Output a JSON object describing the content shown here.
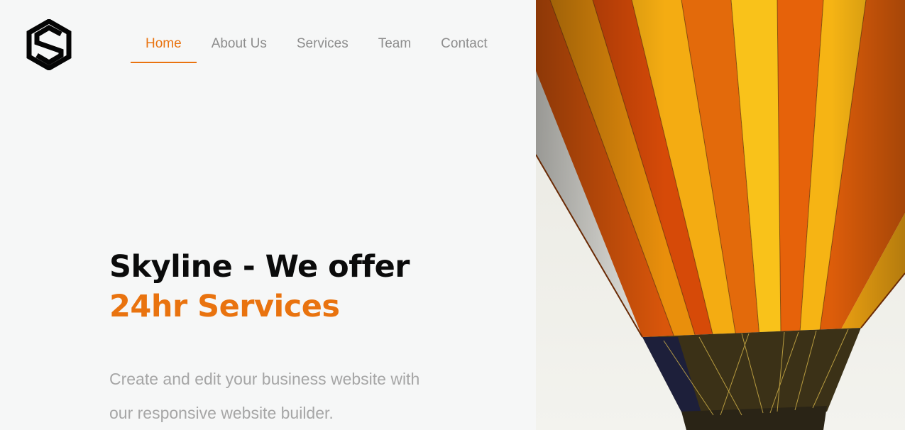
{
  "brand": {
    "logo_icon": "hexagon-s-logo-icon",
    "accent_color": "#e9730f"
  },
  "nav": {
    "items": [
      {
        "label": "Home",
        "active": true
      },
      {
        "label": "About Us",
        "active": false
      },
      {
        "label": "Services",
        "active": false
      },
      {
        "label": "Team",
        "active": false
      },
      {
        "label": "Contact",
        "active": false
      }
    ]
  },
  "hero": {
    "title_line1": "Skyline - We offer",
    "title_line2": "24hr Services",
    "description": "Create and edit your business website with our responsive website builder."
  },
  "image": {
    "subject": "hot-air-balloon-photo"
  }
}
